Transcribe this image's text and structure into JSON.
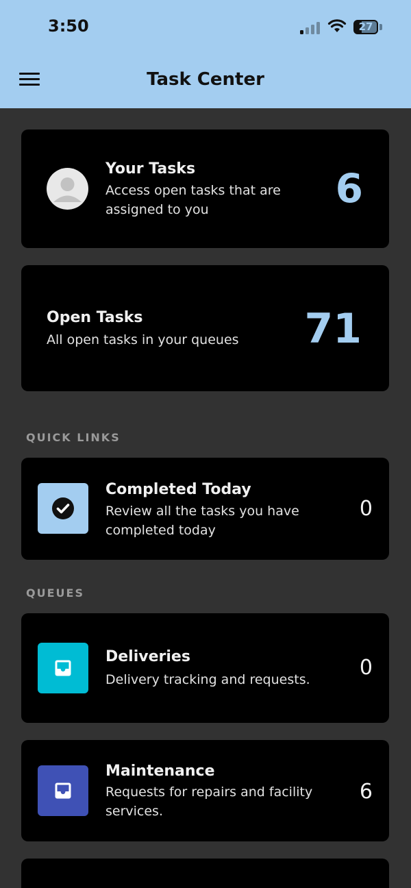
{
  "status_bar": {
    "time": "3:50",
    "battery": "27"
  },
  "header": {
    "title": "Task Center",
    "menu_icon": "hamburger-menu-icon"
  },
  "summary_cards": {
    "your_tasks": {
      "title": "Your Tasks",
      "description": "Access open tasks that are assigned to you",
      "count": "6",
      "icon": "user-avatar-icon"
    },
    "open_tasks": {
      "title": "Open Tasks",
      "description": "All open tasks in your queues",
      "count": "71"
    }
  },
  "quick_links": {
    "label": "QUICK LINKS",
    "items": [
      {
        "title": "Completed Today",
        "description": "Review all the tasks you have completed today",
        "count": "0",
        "icon": "check-circle-icon",
        "icon_bg": "#a3cdf0"
      }
    ]
  },
  "queues": {
    "label": "QUEUES",
    "items": [
      {
        "title": "Deliveries",
        "description": "Delivery tracking and requests.",
        "count": "0",
        "icon": "inbox-icon",
        "icon_bg": "#00bcd4"
      },
      {
        "title": "Maintenance",
        "description": "Requests for repairs and facility services.",
        "count": "6",
        "icon": "inbox-icon",
        "icon_bg": "#3f51b5"
      }
    ]
  },
  "colors": {
    "header_bg": "#a3cdf0",
    "accent": "#a3cdf0",
    "page_bg": "#323232",
    "card_bg": "#000000"
  }
}
